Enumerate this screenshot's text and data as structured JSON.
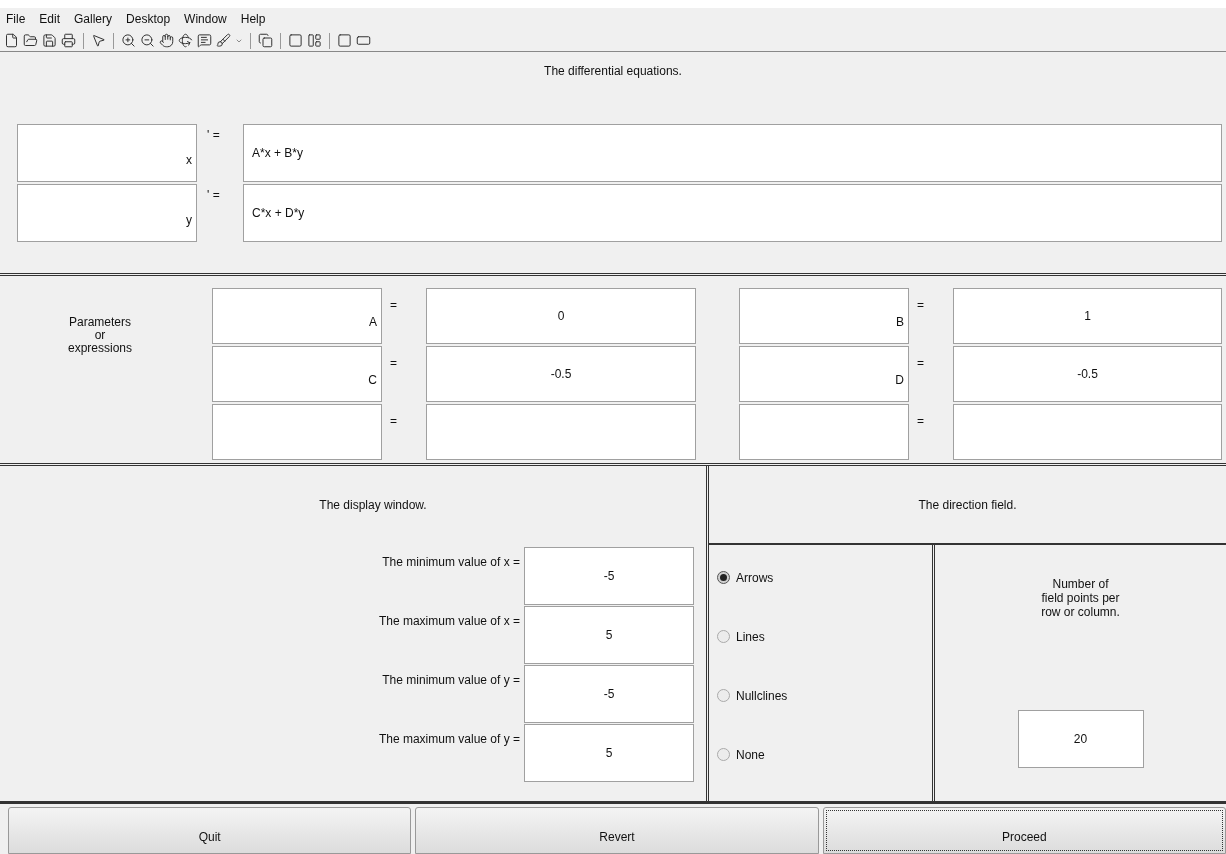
{
  "menu": [
    "File",
    "Edit",
    "Gallery",
    "Desktop",
    "Window",
    "Help"
  ],
  "equations": {
    "title": "The differential equations.",
    "rows": [
      {
        "variable": "x",
        "prime": "' =",
        "expression": "A*x + B*y"
      },
      {
        "variable": "y",
        "prime": "' =",
        "expression": "C*x + D*y"
      }
    ]
  },
  "parameters": {
    "label_lines": [
      "Parameters",
      "or",
      "expressions"
    ],
    "rows": [
      [
        {
          "name": "A",
          "equals": "=",
          "value": "0"
        },
        {
          "name": "B",
          "equals": "=",
          "value": "1"
        }
      ],
      [
        {
          "name": "C",
          "equals": "=",
          "value": "-0.5"
        },
        {
          "name": "D",
          "equals": "=",
          "value": "-0.5"
        }
      ],
      [
        {
          "equals": "="
        },
        {
          "equals": "="
        }
      ]
    ]
  },
  "display": {
    "title": "The display window.",
    "fields": [
      {
        "label": "The minimum value of x =",
        "value": "-5"
      },
      {
        "label": "The maximum value of x =",
        "value": "5"
      },
      {
        "label": "The minimum value of y =",
        "value": "-5"
      },
      {
        "label": "The maximum value of y =",
        "value": "5"
      }
    ]
  },
  "direction": {
    "title": "The direction field.",
    "options": [
      {
        "label": "Arrows",
        "selected": true
      },
      {
        "label": "Lines",
        "selected": false
      },
      {
        "label": "Nullclines",
        "selected": false
      },
      {
        "label": "None",
        "selected": false
      }
    ],
    "points_label_lines": [
      "Number of",
      "field points per",
      "row or column."
    ],
    "points_value": "20"
  },
  "buttons": [
    {
      "label": "Quit",
      "focused": false
    },
    {
      "label": "Revert",
      "focused": false
    },
    {
      "label": "Proceed",
      "focused": true
    }
  ]
}
